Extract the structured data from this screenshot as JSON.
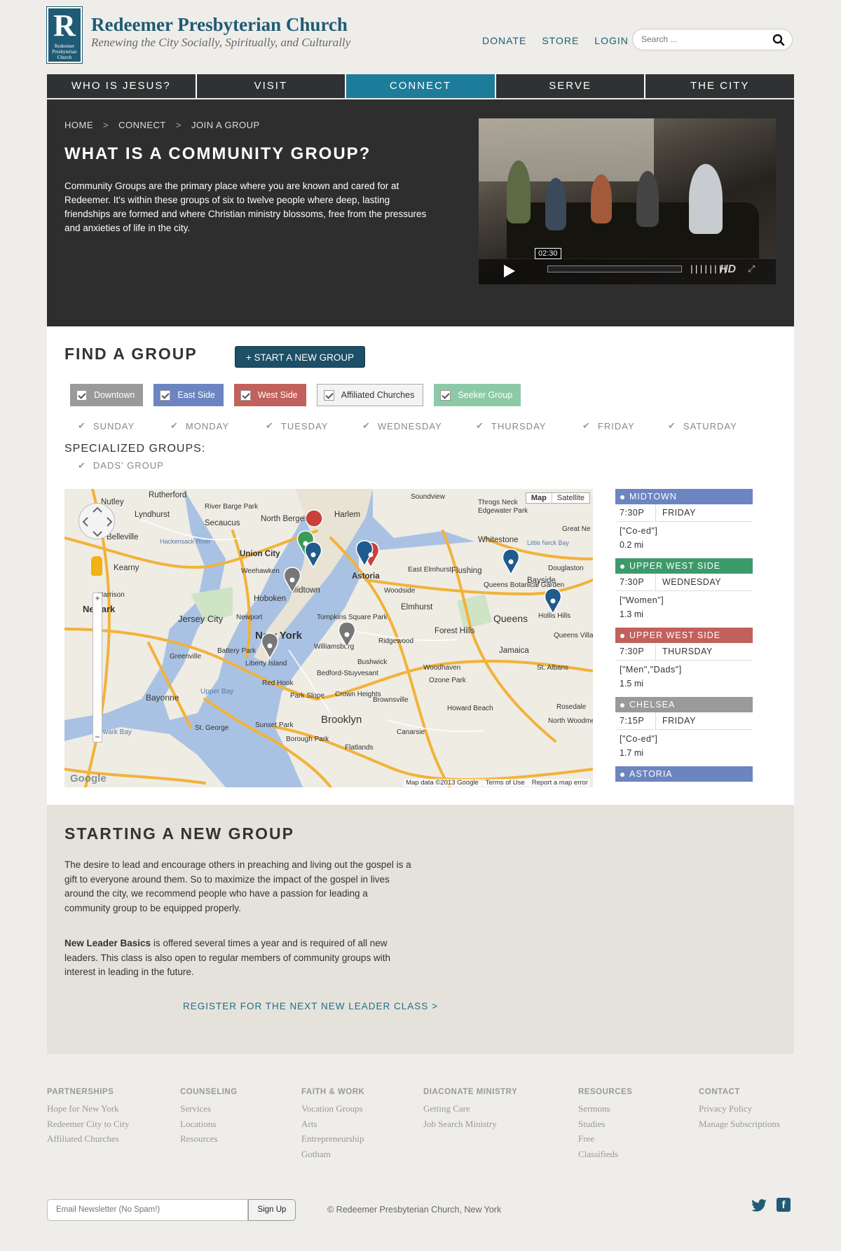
{
  "header": {
    "logo_big": "R",
    "logo_small": "Redeemer Presbyterian Church",
    "title": "Redeemer Presbyterian Church",
    "tagline": "Renewing the City Socially, Spiritually, and Culturally",
    "links": [
      "DONATE",
      "STORE",
      "LOGIN"
    ],
    "search_placeholder": "Search ..."
  },
  "nav": [
    "WHO IS JESUS?",
    "VISIT",
    "CONNECT",
    "SERVE",
    "THE CITY"
  ],
  "nav_active": "CONNECT",
  "hero": {
    "breadcrumb": [
      "HOME",
      "CONNECT",
      "JOIN A GROUP"
    ],
    "breadcrumb_sep": ">",
    "heading": "WHAT IS A COMMUNITY GROUP?",
    "body": "Community Groups are the primary place where you are known and cared for at Redeemer. It's within these groups of six to twelve people where deep, lasting friendships are formed and where Christian ministry blossoms, free from the pressures and anxieties of life in the city.",
    "video_time": "02:30",
    "video_hd": "HD"
  },
  "find": {
    "heading": "FIND A GROUP",
    "start_button": "+ START A NEW GROUP",
    "filters": [
      {
        "label": "Downtown",
        "color": "#9a9a9a"
      },
      {
        "label": "East Side",
        "color": "#6c84c0"
      },
      {
        "label": "West Side",
        "color": "#c2605c"
      },
      {
        "label": "Affiliated Churches",
        "color": "#f3f3f3"
      },
      {
        "label": "Seeker Group",
        "color": "#8ccaa7"
      }
    ],
    "days": [
      "SUNDAY",
      "MONDAY",
      "TUESDAY",
      "WEDNESDAY",
      "THURSDAY",
      "FRIDAY",
      "SATURDAY"
    ],
    "specialized_heading": "SPECIALIZED GROUPS:",
    "specialized": [
      "DADS' GROUP"
    ]
  },
  "map": {
    "toggle": [
      "Map",
      "Satellite"
    ],
    "footer": [
      "Map data ©2013 Google",
      "Terms of Use",
      "Report a map error"
    ],
    "logo": "Google",
    "labels": [
      "Rutherford",
      "Nutley",
      "Lyndhurst",
      "River Barge Park",
      "North Bergen",
      "Harlem",
      "Soundview",
      "Throgs Neck",
      "Edgewater Park",
      "Great Ne",
      "Belleville",
      "Secaucus",
      "Hackensack River",
      "Whitestone",
      "Little Neck Bay",
      "Union City",
      "Kearny",
      "Weehawken",
      "Astoria",
      "East Elmhurst",
      "Flushing",
      "Douglaston",
      "Queens Botanical Garden",
      "Harrison",
      "Hoboken",
      "Midtown",
      "Woodside",
      "Bayside",
      "Newark",
      "Jersey City",
      "Newport",
      "Tompkins Square Park",
      "Elmhurst",
      "Queens",
      "Hollis Hills",
      "New York",
      "Williamsburg",
      "Ridgewood",
      "Forest Hills",
      "Queens Village",
      "Battery Park",
      "Greenville",
      "Jamaica",
      "Liberty Island",
      "Bushwick",
      "Woodhaven",
      "St. Albans",
      "Bedford-Stuyvesant",
      "Ozone Park",
      "Red Hook",
      "Bayonne",
      "Upper Bay",
      "Park Slope",
      "Crown Heights",
      "Brownsville",
      "Rosedale",
      "Howard Beach",
      "North Woodmere Park",
      "Newark Bay",
      "Brooklyn",
      "St. George",
      "Sunset Park",
      "Borough Park",
      "Canarsie",
      "Flatlands"
    ],
    "pins": [
      {
        "color": "#c9403c"
      },
      {
        "color": "#3c9a5a"
      },
      {
        "color": "#1f5b8c"
      },
      {
        "color": "#c9403c"
      },
      {
        "color": "#1f5b8c"
      },
      {
        "color": "#777777"
      },
      {
        "color": "#1f5b8c"
      },
      {
        "color": "#1f5b8c"
      },
      {
        "color": "#777777"
      },
      {
        "color": "#777777"
      }
    ]
  },
  "results": [
    {
      "area": "MIDTOWN",
      "color": "#6c84c0",
      "time": "7:30P",
      "day": "FRIDAY",
      "tags": "[\"Co-ed\"]",
      "dist": "0.2 mi"
    },
    {
      "area": "UPPER WEST SIDE",
      "color": "#3c9a6a",
      "time": "7:30P",
      "day": "WEDNESDAY",
      "tags": "[\"Women\"]",
      "dist": "1.3 mi"
    },
    {
      "area": "UPPER WEST SIDE",
      "color": "#c2605c",
      "time": "7:30P",
      "day": "THURSDAY",
      "tags": "[\"Men\",\"Dads\"]",
      "dist": "1.5 mi"
    },
    {
      "area": "CHELSEA",
      "color": "#9a9a9a",
      "time": "7:15P",
      "day": "FRIDAY",
      "tags": "[\"Co-ed\"]",
      "dist": "1.7 mi"
    },
    {
      "area": "ASTORIA",
      "color": "#6c84c0",
      "time": "",
      "day": "",
      "tags": "",
      "dist": ""
    }
  ],
  "starting": {
    "heading": "STARTING A NEW GROUP",
    "p1": "The desire to lead and encourage others in preaching and living out the gospel is a gift to everyone around them. So to maximize the impact of the gospel in lives around the city, we recommend people who have a passion for leading a community group to be equipped properly.",
    "p2_bold": "New Leader Basics",
    "p2_rest": " is offered several times a year and is required of all new leaders. This class is also open to regular members of community groups with interest in leading in the future.",
    "register": "REGISTER FOR THE NEXT NEW LEADER CLASS >"
  },
  "footer": {
    "columns": [
      {
        "heading": "PARTNERSHIPS",
        "links": [
          "Hope for New York",
          "Redeemer City to City",
          "Affiliated Churches"
        ]
      },
      {
        "heading": "COUNSELING",
        "links": [
          "Services",
          "Locations",
          "Resources"
        ]
      },
      {
        "heading": "FAITH & WORK",
        "links": [
          "Vocation Groups",
          "Arts",
          "Entrepreneurship",
          "Gotham"
        ]
      },
      {
        "heading": "DIACONATE MINISTRY",
        "links": [
          "Getting Care",
          "Job Search Ministry"
        ]
      },
      {
        "heading": "RESOURCES",
        "links": [
          "Sermons",
          "Studies",
          "Free",
          "Classifieds"
        ]
      },
      {
        "heading": "CONTACT",
        "links": [
          "Privacy Policy",
          "Manage Subscriptions"
        ]
      }
    ],
    "newsletter_placeholder": "Email Newsletter (No Spam!)",
    "signup": "Sign Up",
    "copyright": "© Redeemer Presbyterian Church, New York",
    "social": [
      "twitter-icon",
      "facebook-icon"
    ]
  }
}
